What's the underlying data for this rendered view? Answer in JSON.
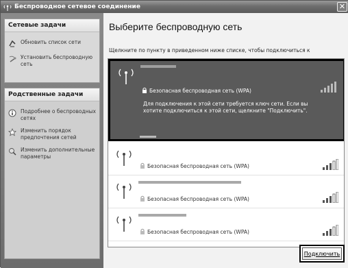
{
  "window": {
    "title": "Беспроводное сетевое соединение",
    "close_label": "✕"
  },
  "sidebar": {
    "network_tasks": {
      "heading": "Сетевые задачи",
      "items": [
        {
          "label": "Обновить список сети",
          "icon": "refresh-icon"
        },
        {
          "label": "Установить беспроводную сеть",
          "icon": "wireless-setup-icon"
        }
      ]
    },
    "related_tasks": {
      "heading": "Родственные задачи",
      "items": [
        {
          "label": "Подробнее о беспроводных сетях",
          "icon": "info-icon"
        },
        {
          "label": "Изменить порядок предпочтения сетей",
          "icon": "star-icon"
        },
        {
          "label": "Изменить дополнительные параметры",
          "icon": "settings-icon"
        }
      ]
    }
  },
  "main": {
    "title": "Выберите беспроводную сеть",
    "hint": "Щелкните по пункту в приведенном ниже списке, чтобы подключиться к"
  },
  "networks": [
    {
      "security": "Безопасная беспроводная сеть (WPA)",
      "description": "Для подключения к этой сети требуется ключ сети. Если вы хотите подключиться к этой сети, щелкните \"Подключить\".",
      "selected": true
    },
    {
      "security": "Безопасная беспроводная сеть (WPA)",
      "selected": false
    },
    {
      "security": "Безопасная беспроводная сеть (WPA)",
      "selected": false
    },
    {
      "security": "Безопасная беспроводная сеть (WPA)",
      "selected": false
    }
  ],
  "actions": {
    "connect_label": "Подключить"
  },
  "colors": {
    "selected_bg": "#5a5a5a",
    "sidebar_bg": "#7a7a7a",
    "titlebar_bg": "#6e6e6e"
  }
}
